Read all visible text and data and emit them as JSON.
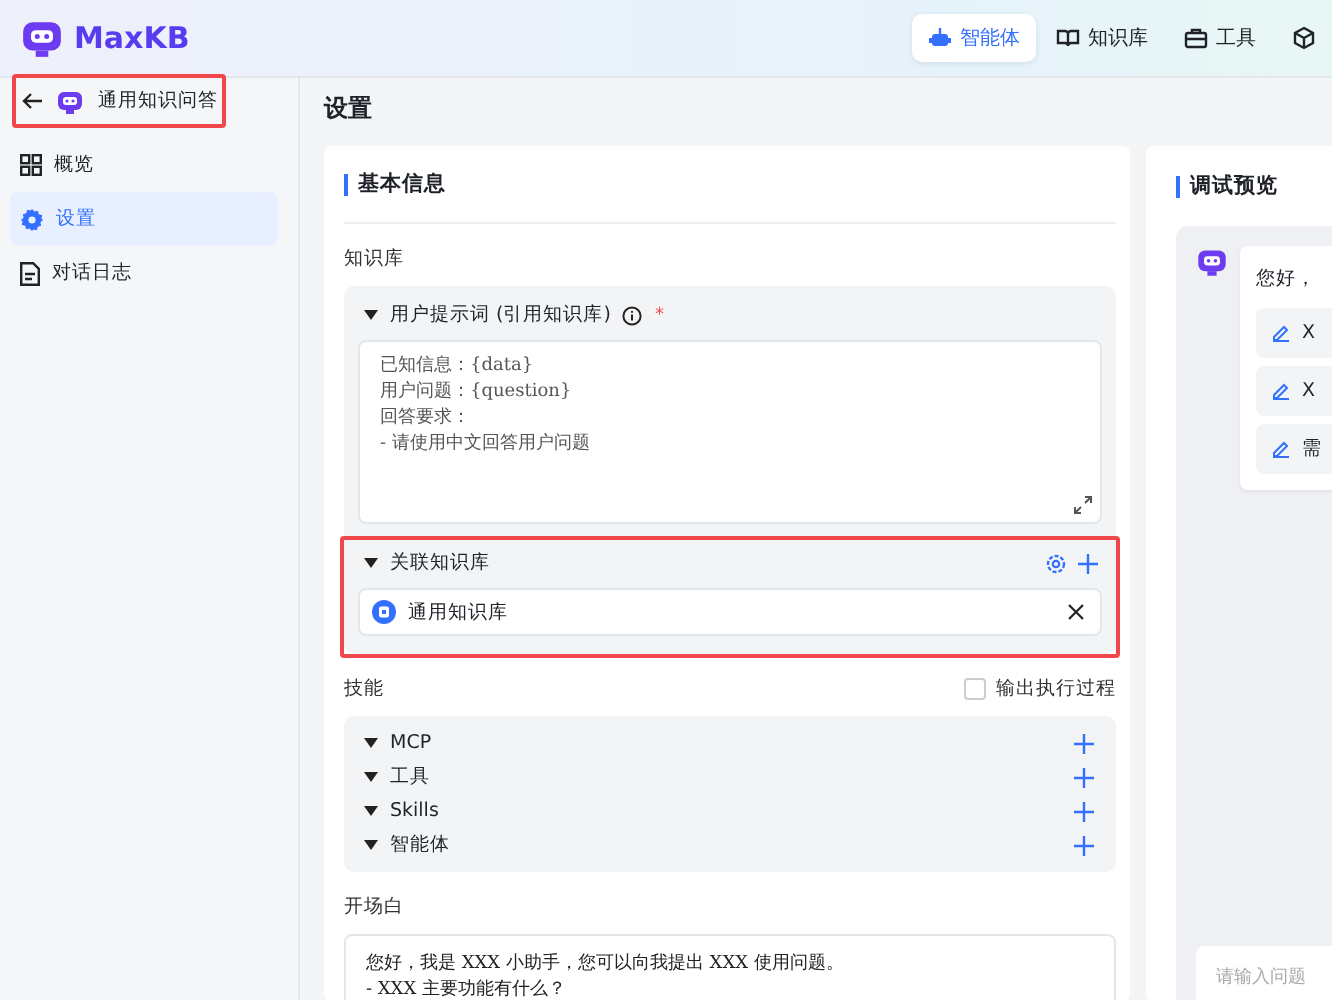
{
  "header": {
    "logo": "MaxKB",
    "nav": [
      {
        "label": "智能体",
        "selected": true
      },
      {
        "label": "知识库",
        "selected": false
      },
      {
        "label": "工具",
        "selected": false
      },
      {
        "selected": false
      }
    ]
  },
  "sidebar": {
    "back_title": "通用知识问答",
    "items": [
      {
        "label": "概览",
        "selected": false
      },
      {
        "label": "设置",
        "selected": true
      },
      {
        "label": "对话日志",
        "selected": false
      }
    ]
  },
  "page_title": "设置",
  "settings": {
    "title": "基本信息",
    "knowledge_label": "知识库",
    "prompt": {
      "label": "用户提示词 (引用知识库)",
      "required_mark": "*",
      "value": "已知信息：{data}\n用户问题：{question}\n回答要求：\n- 请使用中文回答用户问题"
    },
    "linked": {
      "label": "关联知识库",
      "items": [
        {
          "name": "通用知识库"
        }
      ]
    },
    "skills_label": "技能",
    "output_process": {
      "label": "输出执行过程",
      "checked": false
    },
    "skills": [
      {
        "label": "MCP"
      },
      {
        "label": "工具"
      },
      {
        "label": "Skills"
      },
      {
        "label": "智能体"
      }
    ],
    "opening_label": "开场白",
    "opening": "您好，我是 XXX 小助手，您可以向我提出 XXX 使用问题。\n- XXX 主要功能有什么？"
  },
  "preview": {
    "title": "调试预览",
    "greeting": "您好，",
    "suggestions": [
      "X",
      "X",
      "需"
    ],
    "input_placeholder": "请输入问题"
  }
}
